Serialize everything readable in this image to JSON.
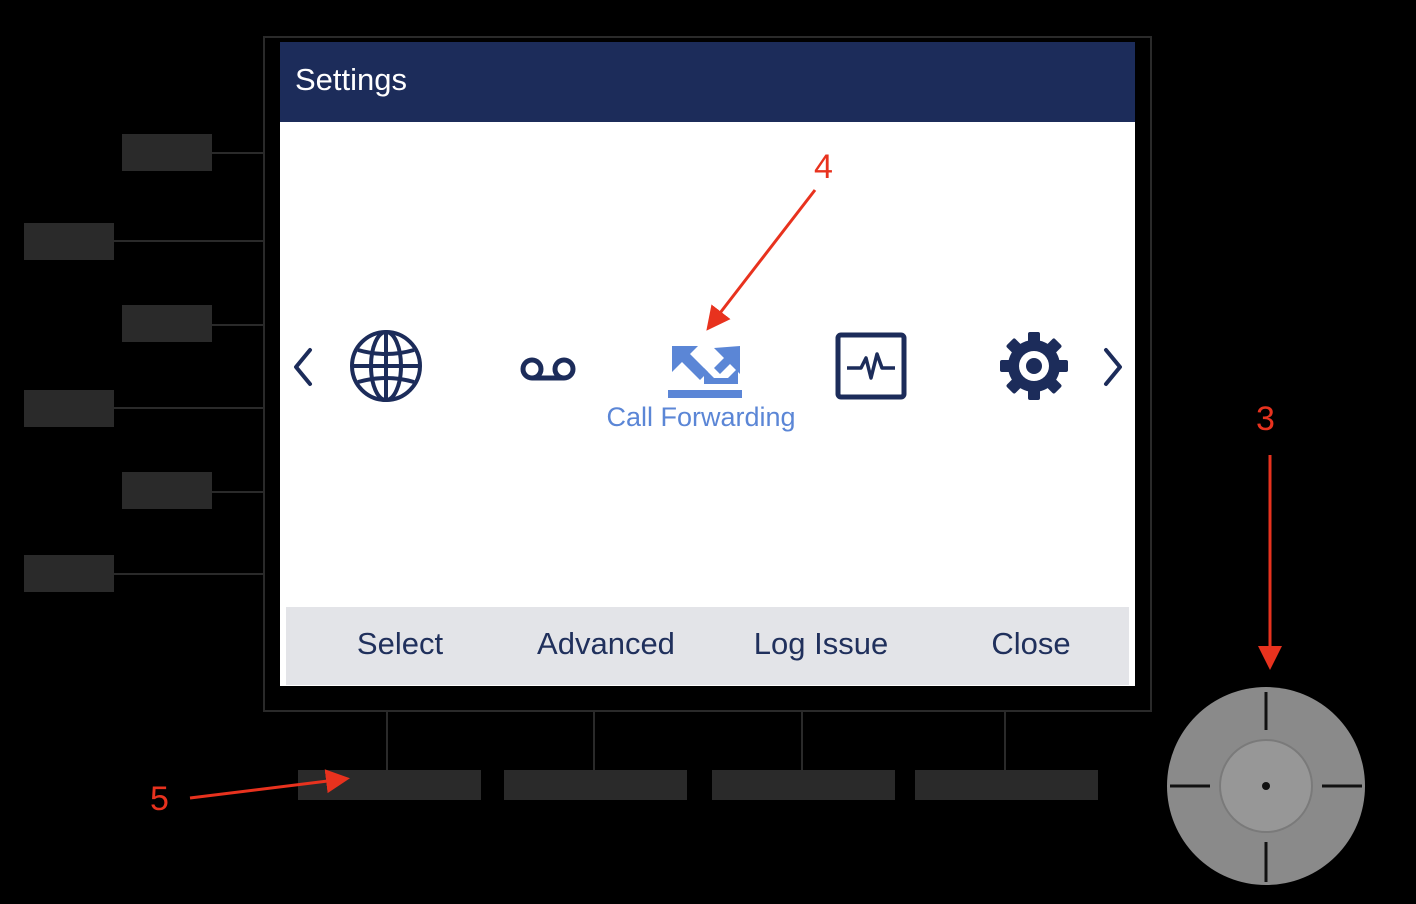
{
  "screen": {
    "title": "Settings",
    "focused_item_label": "Call Forwarding",
    "items": [
      "globe-icon",
      "voicemail-icon",
      "call-forwarding-icon",
      "diagnostics-icon",
      "gear-icon"
    ],
    "accent_color": "#1c2c5a",
    "highlight_color": "#5b86d6"
  },
  "softkeys": [
    "Select",
    "Advanced",
    "Log Issue",
    "Close"
  ],
  "annotations": {
    "a3": "3",
    "a4": "4",
    "a5": "5"
  },
  "annotation_color": "#e8321e"
}
